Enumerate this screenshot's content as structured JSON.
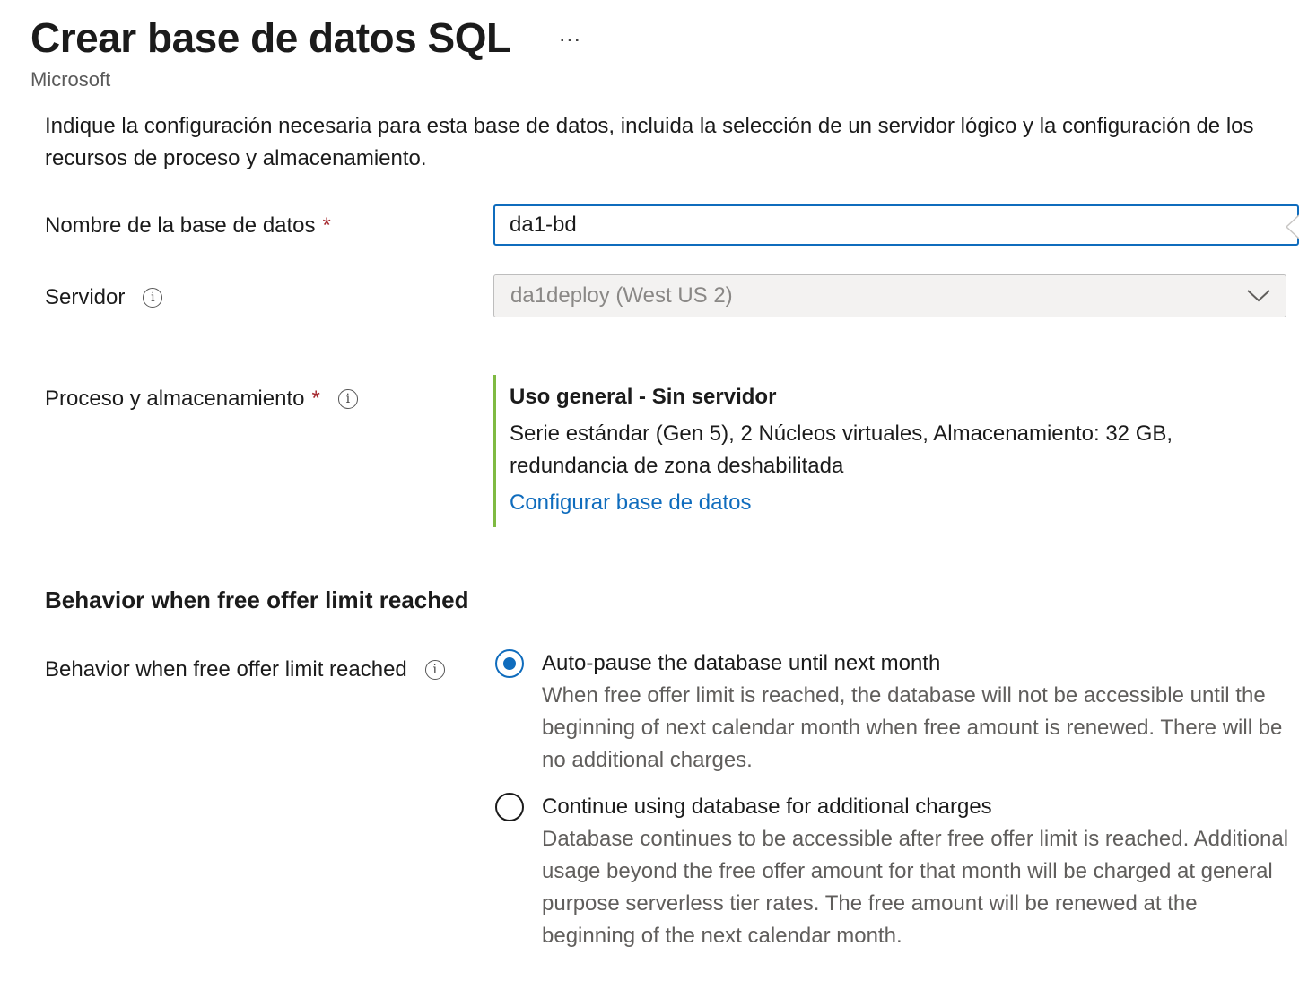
{
  "header": {
    "title": "Crear base de datos SQL",
    "more_menu": "…",
    "publisher": "Microsoft"
  },
  "description": "Indique la configuración necesaria para esta base de datos, incluida la selección de un servidor lógico y la configuración de los recursos de proceso y almacenamiento.",
  "fields": {
    "database_name": {
      "label": "Nombre de la base de datos",
      "required_marker": "*",
      "value": "da1-bd"
    },
    "server": {
      "label": "Servidor",
      "info_icon": "i",
      "selected": "da1deploy (West US 2)",
      "disabled": true
    },
    "compute_storage": {
      "label": "Proceso y almacenamiento",
      "required_marker": "*",
      "info_icon": "i",
      "tier": "Uso general - Sin servidor",
      "spec": "Serie estándar (Gen 5), 2 Núcleos virtuales, Almacenamiento: 32 GB, redundancia de zona deshabilitada",
      "link": "Configurar base de datos"
    }
  },
  "free_offer": {
    "section_heading": "Behavior when free offer limit reached",
    "label": "Behavior when free offer limit reached",
    "info_icon": "i",
    "options": [
      {
        "label": "Auto-pause the database until next month",
        "description": "When free offer limit is reached, the database will not be accessible until the beginning of next calendar month when free amount is renewed. There will be no additional charges.",
        "checked": true
      },
      {
        "label": "Continue using database for additional charges",
        "description": "Database continues to be accessible after free offer limit is reached. Additional usage beyond the free offer amount for that month will be charged at general purpose serverless tier rates. The free amount will be renewed at the beginning of the next calendar month.",
        "checked": false
      }
    ]
  },
  "colors": {
    "accent": "#0f6cbd",
    "required": "#a4262c",
    "compute_border": "#7fba42",
    "disabled_bg": "#f3f2f1",
    "secondary_text": "#605e5c"
  },
  "icons": {
    "info": "info-icon",
    "chevron": "chevron-down-icon",
    "more": "more-icon"
  }
}
